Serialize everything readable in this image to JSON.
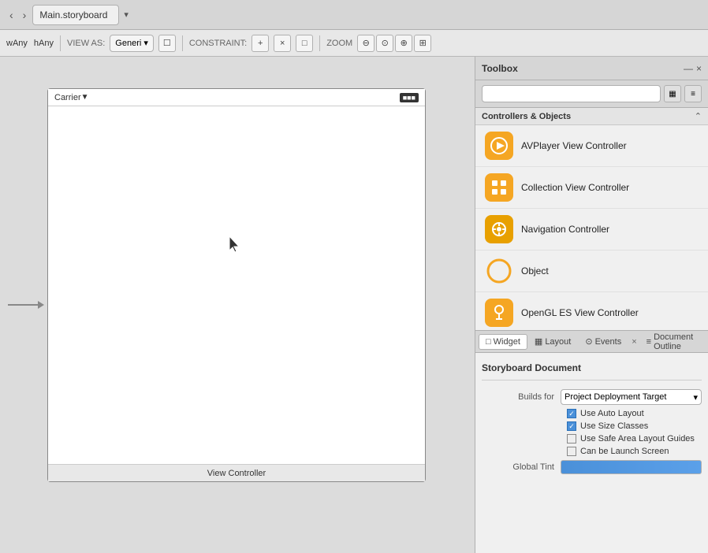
{
  "tabBar": {
    "prevBtn": "‹",
    "nextBtn": "›",
    "tab": {
      "label": "Main.storyboard",
      "closeBtn": "×"
    },
    "dropdownBtn": "▾"
  },
  "toolbar": {
    "wLabel": "wAny",
    "hLabel": "hAny",
    "viewAsLabel": "VIEW AS:",
    "viewAsValue": "Generi",
    "constraintAddBtn": "+",
    "constraintRemoveBtn": "×",
    "constraintToggleBtn": "□",
    "zoomLabel": "ZOOM",
    "zoomOutBtn": "⊖",
    "zoomActualBtn": "⊙",
    "zoomInBtn": "⊕",
    "zoomFitBtn": "⊞"
  },
  "canvas": {
    "deviceLabel": "View Controller",
    "statusBar": {
      "carrier": "Carrier",
      "wifi": "▾",
      "battery": "■■■"
    },
    "arrowLabel": "→"
  },
  "toolbox": {
    "title": "Toolbox",
    "minimizeBtn": "—",
    "closeBtn": "×",
    "searchPlaceholder": "",
    "gridViewBtn": "▦",
    "listViewBtn": "≡",
    "controllersSection": {
      "title": "Controllers & Objects",
      "collapseBtn": "⌃",
      "items": [
        {
          "id": "avplayer",
          "label": "AVPlayer View Controller",
          "iconType": "avplayer"
        },
        {
          "id": "collection",
          "label": "Collection View Controller",
          "iconType": "collection"
        },
        {
          "id": "navigation",
          "label": "Navigation Controller",
          "iconType": "navigation"
        },
        {
          "id": "object",
          "label": "Object",
          "iconType": "object"
        },
        {
          "id": "opengl",
          "label": "OpenGL ES View Controller",
          "iconType": "opengl"
        }
      ]
    }
  },
  "propertiesPanel": {
    "tabs": [
      {
        "id": "widget",
        "label": "Widget",
        "icon": "□",
        "active": true
      },
      {
        "id": "layout",
        "label": "Layout",
        "icon": "▦"
      },
      {
        "id": "events",
        "label": "Events",
        "icon": "⊙"
      }
    ],
    "docOutlineTab": "Document Outline",
    "closeBtn": "×",
    "sectionTitle": "Storyboard Document",
    "buildsForLabel": "Builds for",
    "buildsForValue": "Project Deployment Target",
    "checkboxes": [
      {
        "id": "auto-layout",
        "label": "Use Auto Layout",
        "checked": true
      },
      {
        "id": "size-classes",
        "label": "Use Size Classes",
        "checked": true
      },
      {
        "id": "safe-area",
        "label": "Use Safe Area Layout Guides",
        "checked": false
      },
      {
        "id": "launch-screen",
        "label": "Can be Launch Screen",
        "checked": false
      }
    ],
    "globalTintLabel": "Global Tint"
  },
  "colors": {
    "accent": "#f5a623",
    "tint": "#4a90d9"
  }
}
